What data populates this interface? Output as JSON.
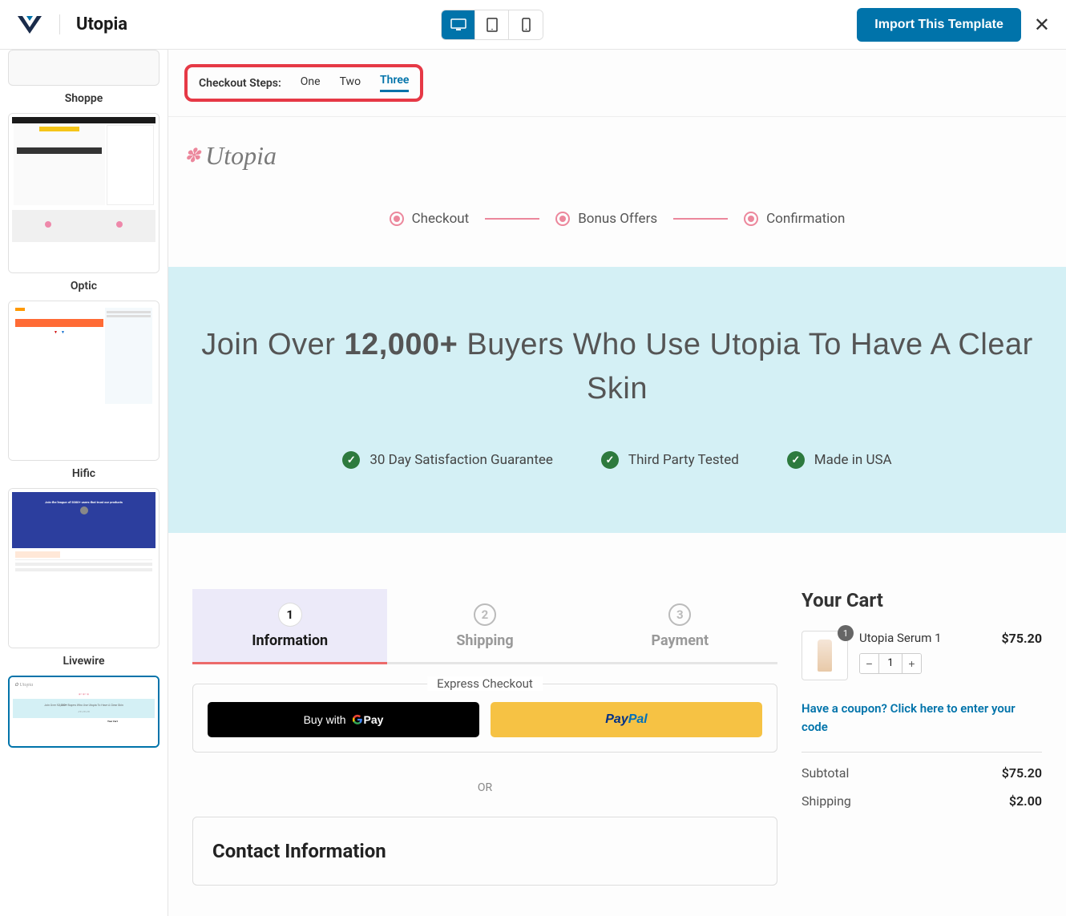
{
  "header": {
    "template_name": "Utopia",
    "import_label": "Import This Template"
  },
  "sidebar": {
    "templates": [
      {
        "label": "Shoppe"
      },
      {
        "label": "Optic"
      },
      {
        "label": "Hific"
      },
      {
        "label": "Livewire"
      }
    ]
  },
  "steps_nav": {
    "label": "Checkout Steps:",
    "items": [
      "One",
      "Two",
      "Three"
    ],
    "active": "Three"
  },
  "brand": {
    "name": "Utopia"
  },
  "progress": {
    "steps": [
      "Checkout",
      "Bonus Offers",
      "Confirmation"
    ]
  },
  "hero": {
    "title_prefix": "Join Over ",
    "title_strong": "12,000+",
    "title_suffix": " Buyers Who Use Utopia To Have A Clear Skin",
    "badges": [
      "30 Day Satisfaction Guarantee",
      "Third Party Tested",
      "Made in USA"
    ]
  },
  "form_tabs": [
    {
      "num": "1",
      "label": "Information",
      "active": true
    },
    {
      "num": "2",
      "label": "Shipping",
      "active": false
    },
    {
      "num": "3",
      "label": "Payment",
      "active": false
    }
  ],
  "express": {
    "title": "Express Checkout",
    "gpay_text": "Buy with",
    "or": "OR"
  },
  "contact": {
    "title": "Contact Information"
  },
  "cart": {
    "title": "Your Cart",
    "item": {
      "name": "Utopia Serum 1",
      "price": "$75.20",
      "qty_badge": "1",
      "qty": "1"
    },
    "coupon_text": "Have a coupon? Click here to enter your code",
    "rows": [
      {
        "label": "Subtotal",
        "value": "$75.20"
      },
      {
        "label": "Shipping",
        "value": "$2.00"
      }
    ]
  }
}
